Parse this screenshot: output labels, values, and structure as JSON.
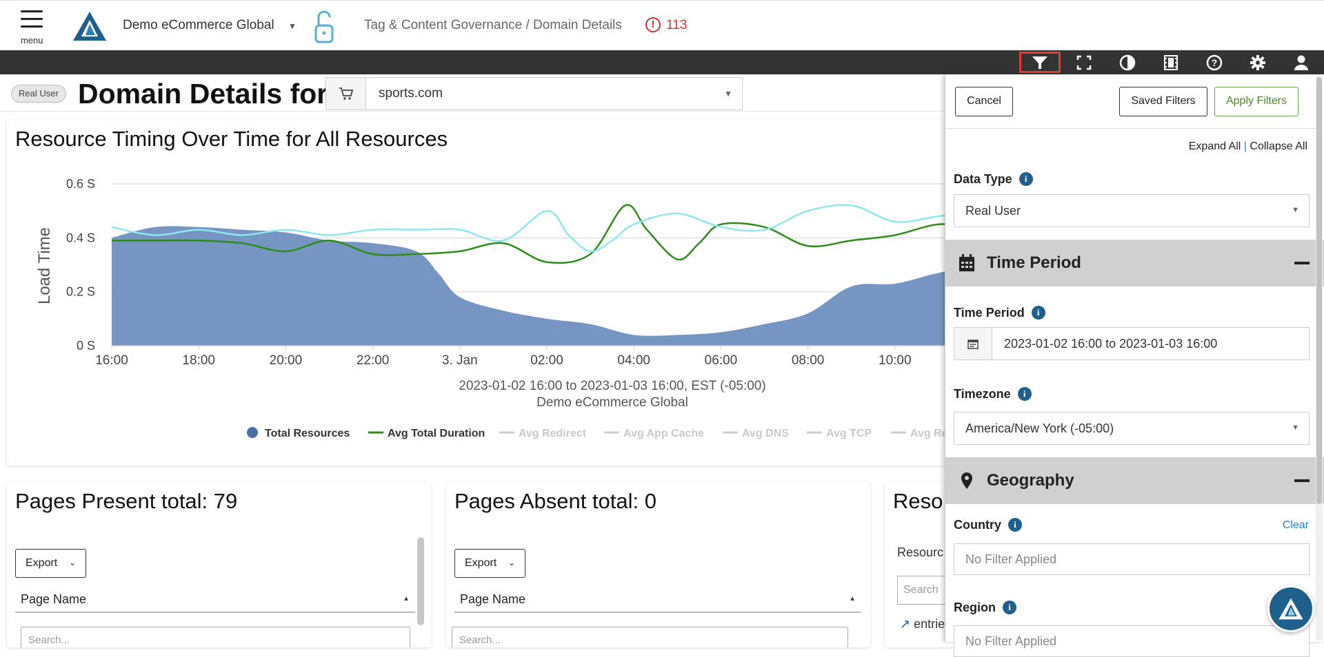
{
  "header": {
    "menu_label": "menu",
    "account_name": "Demo eCommerce Global",
    "breadcrumb": "Tag & Content Governance / Domain Details",
    "alert_count": "113"
  },
  "toolbar": {
    "icons": [
      "filter-icon",
      "fullscreen-icon",
      "contrast-icon",
      "film-icon",
      "help-icon",
      "gear-icon",
      "user-icon"
    ]
  },
  "page": {
    "badge": "Real User",
    "title": "Domain Details for",
    "domain": "sports.com"
  },
  "chart": {
    "title": "Resource Timing Over Time for All Resources",
    "subtitle_line1": "2023-01-02 16:00 to 2023-01-03 16:00, EST (-05:00)",
    "subtitle_line2": "Demo eCommerce Global",
    "legend": [
      {
        "label": "Total Resources",
        "active": true,
        "color": "#4a6fa5"
      },
      {
        "label": "Avg Total Duration",
        "active": true,
        "color": "#2e8b1a"
      },
      {
        "label": "Avg Redirect",
        "active": false,
        "color": "#cccccc"
      },
      {
        "label": "Avg App Cache",
        "active": false,
        "color": "#cccccc"
      },
      {
        "label": "Avg DNS",
        "active": false,
        "color": "#cccccc"
      },
      {
        "label": "Avg TCP",
        "active": false,
        "color": "#cccccc"
      },
      {
        "label": "Avg Red",
        "active": false,
        "color": "#cccccc"
      }
    ]
  },
  "chart_data": {
    "type": "area",
    "title": "Resource Timing Over Time for All Resources",
    "ylabel": "Load Time",
    "ylim": [
      0,
      0.6
    ],
    "y_ticks": [
      "0 S",
      "0.2 S",
      "0.4 S",
      "0.6 S"
    ],
    "x_ticks": [
      "16:00",
      "18:00",
      "20:00",
      "22:00",
      "3. Jan",
      "02:00",
      "04:00",
      "06:00",
      "08:00",
      "10:00"
    ],
    "x_hours": [
      0,
      2,
      4,
      6,
      8,
      10,
      12,
      14,
      16,
      18
    ],
    "series": [
      {
        "name": "Total Resources",
        "kind": "area",
        "color": "#4a6fa5",
        "x": [
          0,
          1,
          2,
          3,
          4,
          5,
          6,
          7,
          7.5,
          8,
          9,
          10,
          11,
          12,
          13,
          14,
          15,
          16,
          17,
          18,
          19,
          20
        ],
        "y": [
          0.4,
          0.44,
          0.44,
          0.43,
          0.42,
          0.39,
          0.38,
          0.35,
          0.27,
          0.18,
          0.13,
          0.1,
          0.08,
          0.04,
          0.04,
          0.05,
          0.08,
          0.12,
          0.22,
          0.23,
          0.27,
          0.3
        ]
      },
      {
        "name": "Avg Total Duration",
        "kind": "line",
        "color": "#2e8b1a",
        "x": [
          0,
          1,
          2,
          3,
          4,
          5,
          6,
          7,
          8,
          9,
          10,
          11,
          11.8,
          12.3,
          13,
          13.5,
          14,
          15,
          16,
          17,
          18,
          19,
          20
        ],
        "y": [
          0.39,
          0.39,
          0.39,
          0.38,
          0.35,
          0.39,
          0.34,
          0.34,
          0.35,
          0.38,
          0.31,
          0.34,
          0.52,
          0.43,
          0.32,
          0.38,
          0.45,
          0.44,
          0.37,
          0.39,
          0.41,
          0.45,
          0.44
        ]
      },
      {
        "name": "Avg Total Duration (light)",
        "kind": "line",
        "color": "#8fe6f0",
        "x": [
          0,
          1,
          2,
          3,
          4,
          5,
          6,
          7,
          8,
          9,
          10,
          10.5,
          11,
          11.5,
          12,
          13,
          14,
          15,
          16,
          17,
          18,
          19,
          20
        ],
        "y": [
          0.44,
          0.41,
          0.43,
          0.41,
          0.43,
          0.41,
          0.43,
          0.43,
          0.43,
          0.39,
          0.5,
          0.41,
          0.35,
          0.39,
          0.45,
          0.49,
          0.44,
          0.43,
          0.5,
          0.52,
          0.46,
          0.48,
          0.5
        ]
      }
    ]
  },
  "cards": [
    {
      "title": "Pages Present total: 79",
      "export_label": "Export",
      "column": "Page Name",
      "search_placeholder": "Search..."
    },
    {
      "title": "Pages Absent total: 0",
      "export_label": "Export",
      "column": "Page Name",
      "search_placeholder": "Search..."
    },
    {
      "title": "Reso",
      "label": "Resourc",
      "search_placeholder": "Search",
      "entries": "entrie"
    }
  ],
  "filters": {
    "cancel": "Cancel",
    "saved": "Saved Filters",
    "apply": "Apply Filters",
    "expand_all": "Expand All",
    "separator": "|",
    "collapse_all": "Collapse All",
    "data_type_label": "Data Type",
    "data_type_value": "Real User",
    "time_section": "Time Period",
    "time_label": "Time Period",
    "time_value": "2023-01-02 16:00 to 2023-01-03 16:00",
    "timezone_label": "Timezone",
    "timezone_value": "America/New York (-05:00)",
    "geo_section": "Geography",
    "country_label": "Country",
    "country_clear": "Clear",
    "country_value": "No Filter Applied",
    "region_label": "Region",
    "region_value": "No Filter Applied"
  }
}
